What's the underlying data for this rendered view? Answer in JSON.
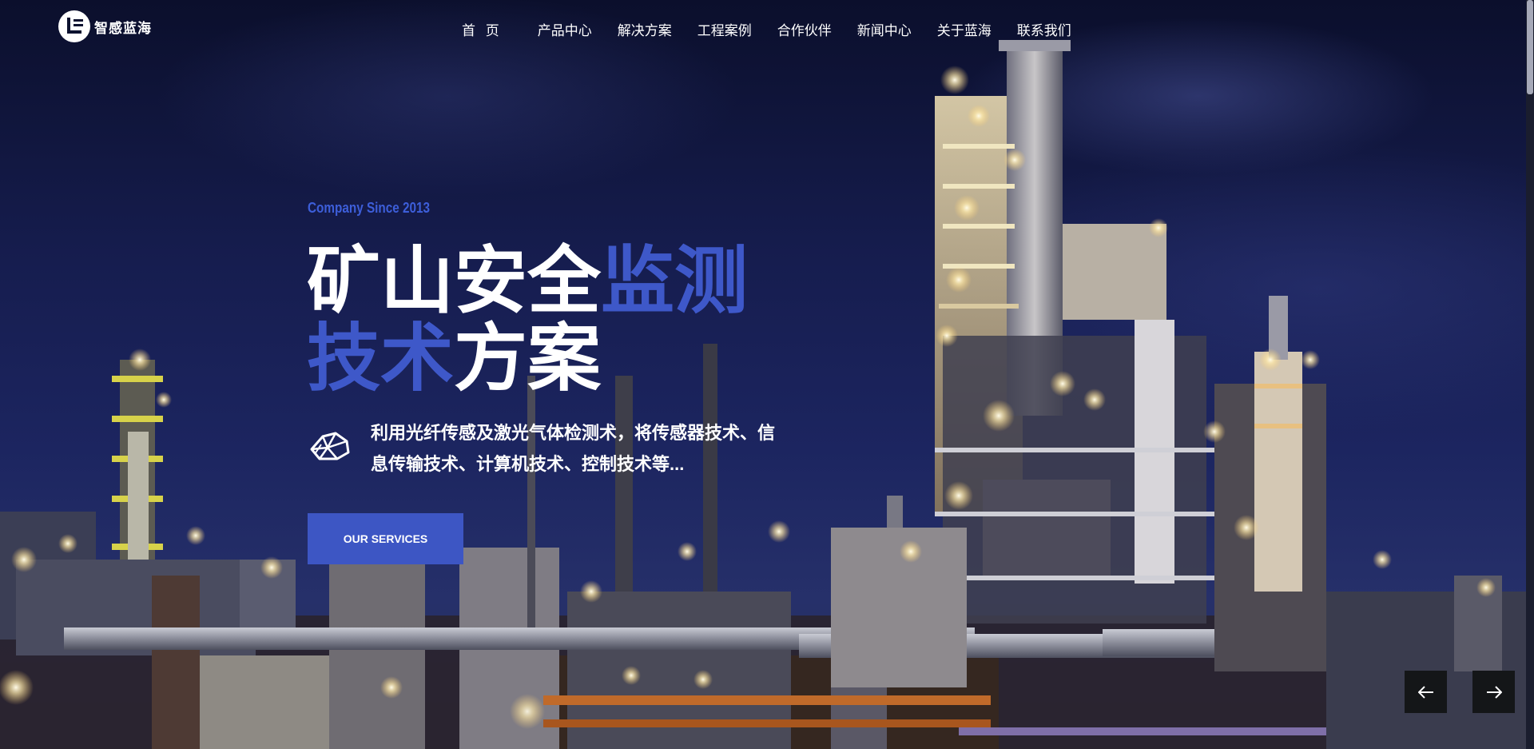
{
  "header": {
    "logo_text": "智感蓝海",
    "nav": [
      "首 页",
      "产品中心",
      "解决方案",
      "工程案例",
      "合作伙伴",
      "新闻中心",
      "关于蓝海",
      "联系我们"
    ]
  },
  "hero": {
    "tagline": "Company Since 2013",
    "headline": {
      "line1_white": "矿山安全",
      "line1_accent": "监测",
      "line2_accent": "技术",
      "line2_white": "方案"
    },
    "description": "利用光纤传感及激光气体检测术，将传感器技术、信息传输技术、计算机技术、控制技术等...",
    "cta_label": "OUR SERVICES"
  },
  "slider": {
    "prev_icon": "arrow-left-icon",
    "next_icon": "arrow-right-icon"
  },
  "colors": {
    "accent": "#3e58c9",
    "button": "#3d56c4",
    "text": "#ffffff"
  }
}
